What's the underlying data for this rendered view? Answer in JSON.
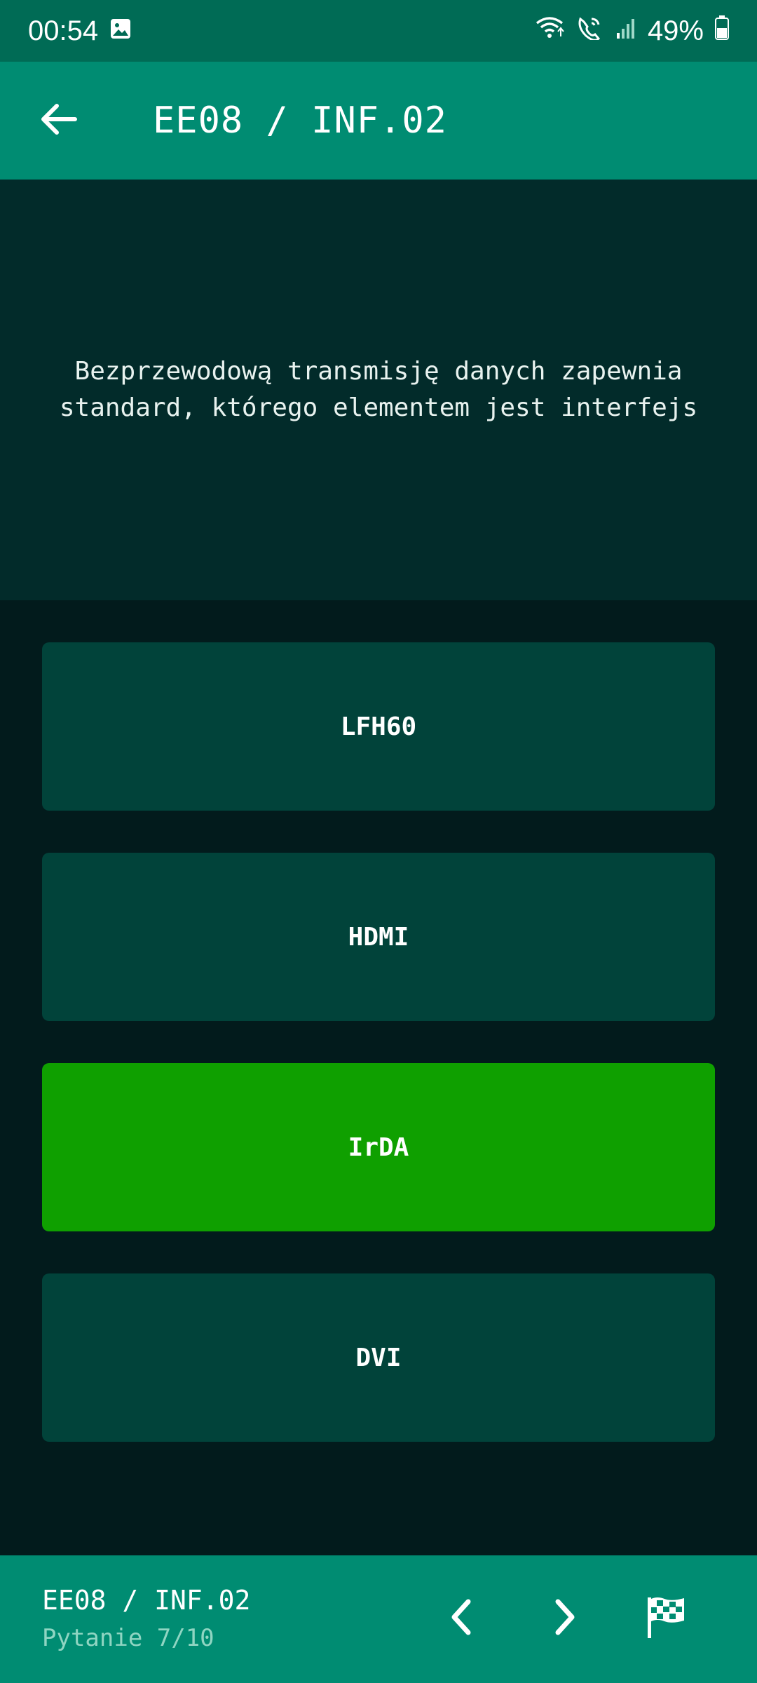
{
  "status_bar": {
    "time": "00:54",
    "battery": "49%",
    "icons": [
      "image-icon",
      "wifi-icon",
      "wifi-calling-icon",
      "signal-icon",
      "battery-icon"
    ]
  },
  "app_bar": {
    "title": "EE08 / INF.02",
    "back_icon": "arrow-left-icon"
  },
  "question": {
    "text": "Bezprzewodową transmisję danych zapewnia standard, którego elementem jest interfejs"
  },
  "answers": [
    {
      "label": "LFH60",
      "state": "default"
    },
    {
      "label": "HDMI",
      "state": "default"
    },
    {
      "label": "IrDA",
      "state": "correct"
    },
    {
      "label": "DVI",
      "state": "default"
    }
  ],
  "bottom_bar": {
    "title": "EE08 / INF.02",
    "progress": "Pytanie 7/10",
    "icons": [
      "chevron-left-icon",
      "chevron-right-icon",
      "checkered-flag-icon"
    ]
  },
  "colors": {
    "status_bar": "#006b55",
    "app_bar": "#008c72",
    "question_bg": "#022b2a",
    "background": "#021b1c",
    "answer_default": "#01433a",
    "answer_correct": "#0fa000"
  }
}
